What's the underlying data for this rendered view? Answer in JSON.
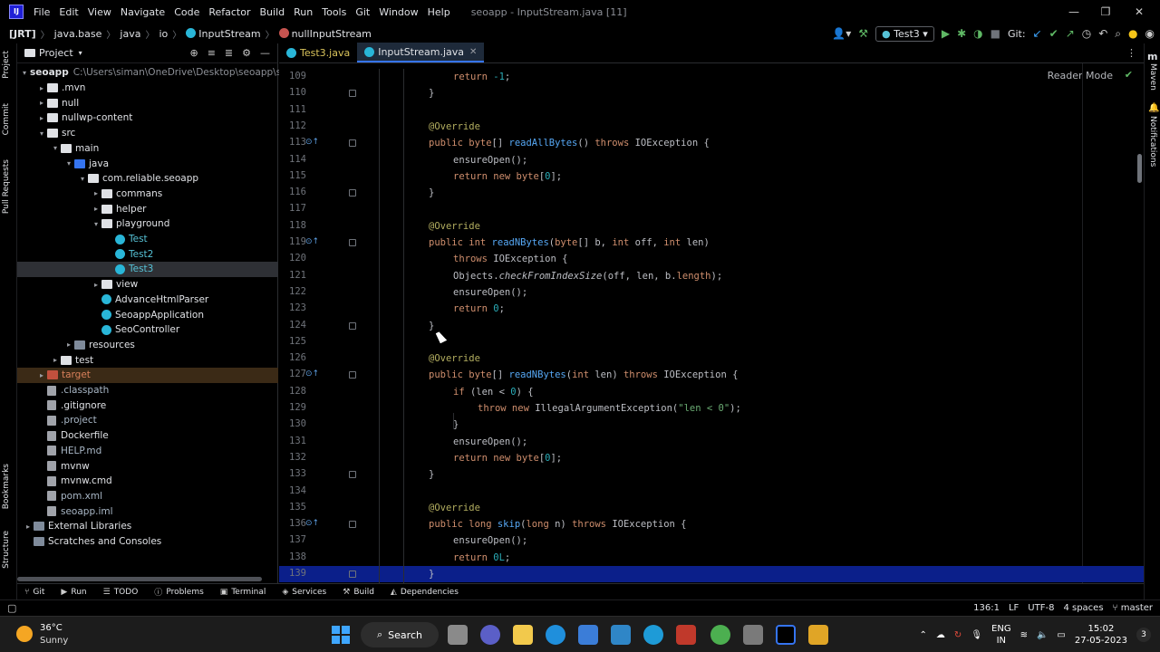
{
  "app": {
    "logo_text": "IJ",
    "menu": [
      "File",
      "Edit",
      "View",
      "Navigate",
      "Code",
      "Refactor",
      "Build",
      "Run",
      "Tools",
      "Git",
      "Window",
      "Help"
    ],
    "window_title": "seoapp - InputStream.java [11]"
  },
  "breadcrumb": {
    "items": [
      "[JRT]",
      "java.base",
      "java",
      "io",
      "InputStream",
      "nullInputStream"
    ]
  },
  "toolbar": {
    "run_config": "Test3",
    "git_label": "Git:"
  },
  "left_stripe": {
    "tabs": [
      "Project",
      "Commit",
      "Pull Requests",
      "Bookmarks",
      "Structure"
    ]
  },
  "right_stripe": {
    "tabs": [
      "Maven",
      "Notifications"
    ]
  },
  "project": {
    "title": "Project",
    "tree": [
      {
        "label": "seoapp",
        "hint": "C:\\Users\\siman\\OneDrive\\Desktop\\seoapp\\seoa",
        "depth": 0,
        "arrow": "▾",
        "icon": "folder",
        "bold": true
      },
      {
        "label": ".mvn",
        "depth": 1,
        "arrow": "▸",
        "icon": "folder"
      },
      {
        "label": "null",
        "depth": 1,
        "arrow": "▸",
        "icon": "folder"
      },
      {
        "label": "nullwp-content",
        "depth": 1,
        "arrow": "▸",
        "icon": "folder"
      },
      {
        "label": "src",
        "depth": 1,
        "arrow": "▾",
        "icon": "folder"
      },
      {
        "label": "main",
        "depth": 2,
        "arrow": "▾",
        "icon": "folder"
      },
      {
        "label": "java",
        "depth": 3,
        "arrow": "▾",
        "icon": "folder-blue"
      },
      {
        "label": "com.reliable.seoapp",
        "depth": 4,
        "arrow": "▾",
        "icon": "folder"
      },
      {
        "label": "commans",
        "depth": 5,
        "arrow": "▸",
        "icon": "folder"
      },
      {
        "label": "helper",
        "depth": 5,
        "arrow": "▸",
        "icon": "folder"
      },
      {
        "label": "playground",
        "depth": 5,
        "arrow": "▾",
        "icon": "folder"
      },
      {
        "label": "Test",
        "depth": 6,
        "arrow": "",
        "icon": "class",
        "color": "#56c2d6"
      },
      {
        "label": "Test2",
        "depth": 6,
        "arrow": "",
        "icon": "class",
        "color": "#56c2d6"
      },
      {
        "label": "Test3",
        "depth": 6,
        "arrow": "",
        "icon": "class",
        "color": "#56c2d6",
        "selected": true
      },
      {
        "label": "view",
        "depth": 5,
        "arrow": "▸",
        "icon": "folder"
      },
      {
        "label": "AdvanceHtmlParser",
        "depth": 5,
        "arrow": "",
        "icon": "class"
      },
      {
        "label": "SeoappApplication",
        "depth": 5,
        "arrow": "",
        "icon": "class"
      },
      {
        "label": "SeoController",
        "depth": 5,
        "arrow": "",
        "icon": "class"
      },
      {
        "label": "resources",
        "depth": 3,
        "arrow": "▸",
        "icon": "folder-lib"
      },
      {
        "label": "test",
        "depth": 2,
        "arrow": "▸",
        "icon": "folder"
      },
      {
        "label": "target",
        "depth": 1,
        "arrow": "▸",
        "icon": "folder-orange",
        "color": "#d9805b",
        "excluded": true
      },
      {
        "label": ".classpath",
        "depth": 1,
        "arrow": "",
        "icon": "file",
        "color": "#a9b7c6"
      },
      {
        "label": ".gitignore",
        "depth": 1,
        "arrow": "",
        "icon": "file"
      },
      {
        "label": ".project",
        "depth": 1,
        "arrow": "",
        "icon": "file",
        "color": "#a9b7c6"
      },
      {
        "label": "Dockerfile",
        "depth": 1,
        "arrow": "",
        "icon": "file"
      },
      {
        "label": "HELP.md",
        "depth": 1,
        "arrow": "",
        "icon": "file",
        "color": "#a9b7c6"
      },
      {
        "label": "mvnw",
        "depth": 1,
        "arrow": "",
        "icon": "file"
      },
      {
        "label": "mvnw.cmd",
        "depth": 1,
        "arrow": "",
        "icon": "file"
      },
      {
        "label": "pom.xml",
        "depth": 1,
        "arrow": "",
        "icon": "file",
        "color": "#a9b7c6"
      },
      {
        "label": "seoapp.iml",
        "depth": 1,
        "arrow": "",
        "icon": "file",
        "color": "#a9b7c6"
      },
      {
        "label": "External Libraries",
        "depth": 0,
        "arrow": "▸",
        "icon": "folder-lib"
      },
      {
        "label": "Scratches and Consoles",
        "depth": 0,
        "arrow": "",
        "icon": "folder-lib"
      }
    ]
  },
  "editor": {
    "tabs": [
      {
        "label": "Test3.java",
        "active": false
      },
      {
        "label": "InputStream.java",
        "active": true
      }
    ],
    "reader_mode": "Reader Mode",
    "lines": [
      {
        "n": "109",
        "indent": 2,
        "code": [
          [
            "kw",
            "return "
          ],
          [
            "num",
            "-1"
          ],
          [
            "",
            "; "
          ]
        ]
      },
      {
        "n": "110",
        "indent": 1,
        "code": [
          [
            "",
            "}"
          ]
        ]
      },
      {
        "n": "111",
        "indent": 0,
        "code": []
      },
      {
        "n": "112",
        "indent": 1,
        "code": [
          [
            "ann",
            "@Override"
          ]
        ]
      },
      {
        "n": "113",
        "indent": 1,
        "override": true,
        "code": [
          [
            "kw",
            "public byte"
          ],
          [
            "",
            "[] "
          ],
          [
            "fn",
            "readAllBytes"
          ],
          [
            "",
            "() "
          ],
          [
            "kw",
            "throws "
          ],
          [
            "",
            "IOException {"
          ]
        ]
      },
      {
        "n": "114",
        "indent": 2,
        "code": [
          [
            "",
            "ensureOpen();"
          ]
        ]
      },
      {
        "n": "115",
        "indent": 2,
        "code": [
          [
            "kw",
            "return new byte"
          ],
          [
            "",
            "["
          ],
          [
            "num",
            "0"
          ],
          [
            "",
            "];"
          ]
        ]
      },
      {
        "n": "116",
        "indent": 1,
        "code": [
          [
            "",
            "}"
          ]
        ]
      },
      {
        "n": "117",
        "indent": 0,
        "code": []
      },
      {
        "n": "118",
        "indent": 1,
        "code": [
          [
            "ann",
            "@Override"
          ]
        ]
      },
      {
        "n": "119",
        "indent": 1,
        "override": true,
        "code": [
          [
            "kw",
            "public int "
          ],
          [
            "fn",
            "readNBytes"
          ],
          [
            "",
            "("
          ],
          [
            "kw",
            "byte"
          ],
          [
            "",
            "[] b, "
          ],
          [
            "kw",
            "int "
          ],
          [
            "",
            "off, "
          ],
          [
            "kw",
            "int "
          ],
          [
            "",
            "len)"
          ]
        ]
      },
      {
        "n": "120",
        "indent": 2,
        "code": [
          [
            "kw",
            "throws "
          ],
          [
            "",
            "IOException {"
          ]
        ]
      },
      {
        "n": "121",
        "indent": 2,
        "code": [
          [
            "",
            "Objects."
          ],
          [
            "it",
            "checkFromIndexSize"
          ],
          [
            "",
            "(off, len, b."
          ],
          [
            "kw",
            "length"
          ],
          [
            "",
            "); "
          ]
        ]
      },
      {
        "n": "122",
        "indent": 2,
        "code": [
          [
            "",
            "ensureOpen();"
          ]
        ]
      },
      {
        "n": "123",
        "indent": 2,
        "code": [
          [
            "kw",
            "return "
          ],
          [
            "num",
            "0"
          ],
          [
            "",
            ";"
          ]
        ]
      },
      {
        "n": "124",
        "indent": 1,
        "code": [
          [
            "",
            "}"
          ]
        ]
      },
      {
        "n": "125",
        "indent": 0,
        "code": []
      },
      {
        "n": "126",
        "indent": 1,
        "code": [
          [
            "ann",
            "@Override"
          ]
        ]
      },
      {
        "n": "127",
        "indent": 1,
        "override": true,
        "code": [
          [
            "kw",
            "public byte"
          ],
          [
            "",
            "[] "
          ],
          [
            "fn",
            "readNBytes"
          ],
          [
            "",
            "("
          ],
          [
            "kw",
            "int "
          ],
          [
            "",
            "len) "
          ],
          [
            "kw",
            "throws "
          ],
          [
            "",
            "IOException {"
          ]
        ]
      },
      {
        "n": "128",
        "indent": 2,
        "code": [
          [
            "kw",
            "if "
          ],
          [
            "",
            "(len < "
          ],
          [
            "num",
            "0"
          ],
          [
            "",
            ") {"
          ]
        ]
      },
      {
        "n": "129",
        "indent": 3,
        "code": [
          [
            "kw",
            "throw new "
          ],
          [
            "",
            "IllegalArgumentException("
          ],
          [
            "str",
            "\"len < 0\""
          ],
          [
            "",
            ");"
          ]
        ]
      },
      {
        "n": "130",
        "indent": 2,
        "code": [
          [
            "",
            "}"
          ]
        ]
      },
      {
        "n": "131",
        "indent": 2,
        "code": [
          [
            "",
            "ensureOpen();"
          ]
        ]
      },
      {
        "n": "132",
        "indent": 2,
        "code": [
          [
            "kw",
            "return new byte"
          ],
          [
            "",
            "["
          ],
          [
            "num",
            "0"
          ],
          [
            "",
            "];"
          ]
        ]
      },
      {
        "n": "133",
        "indent": 1,
        "code": [
          [
            "",
            "}"
          ]
        ]
      },
      {
        "n": "134",
        "indent": 0,
        "code": []
      },
      {
        "n": "135",
        "indent": 1,
        "code": [
          [
            "ann",
            "@Override"
          ]
        ]
      },
      {
        "n": "136",
        "indent": 1,
        "override": true,
        "code": [
          [
            "kw",
            "public long "
          ],
          [
            "fn",
            "skip"
          ],
          [
            "",
            "("
          ],
          [
            "kw",
            "long "
          ],
          [
            "",
            "n) "
          ],
          [
            "kw",
            "throws "
          ],
          [
            "",
            "IOException {"
          ]
        ]
      },
      {
        "n": "137",
        "indent": 2,
        "code": [
          [
            "",
            "ensureOpen();"
          ]
        ]
      },
      {
        "n": "138",
        "indent": 2,
        "code": [
          [
            "kw",
            "return "
          ],
          [
            "num",
            "0L"
          ],
          [
            "",
            ";"
          ]
        ]
      },
      {
        "n": "139",
        "indent": 1,
        "current": true,
        "code": [
          [
            "",
            "}"
          ]
        ]
      }
    ]
  },
  "tool_windows": [
    "Git",
    "Run",
    "TODO",
    "Problems",
    "Terminal",
    "Services",
    "Build",
    "Dependencies"
  ],
  "status": {
    "position": "136:1",
    "line_sep": "LF",
    "encoding": "UTF-8",
    "indent": "4 spaces",
    "branch": "master"
  },
  "taskbar": {
    "temperature": "36°C",
    "condition": "Sunny",
    "search_label": "Search",
    "lang_top": "ENG",
    "lang_bottom": "IN",
    "time": "15:02",
    "date": "27-05-2023",
    "notif_count": "3"
  }
}
